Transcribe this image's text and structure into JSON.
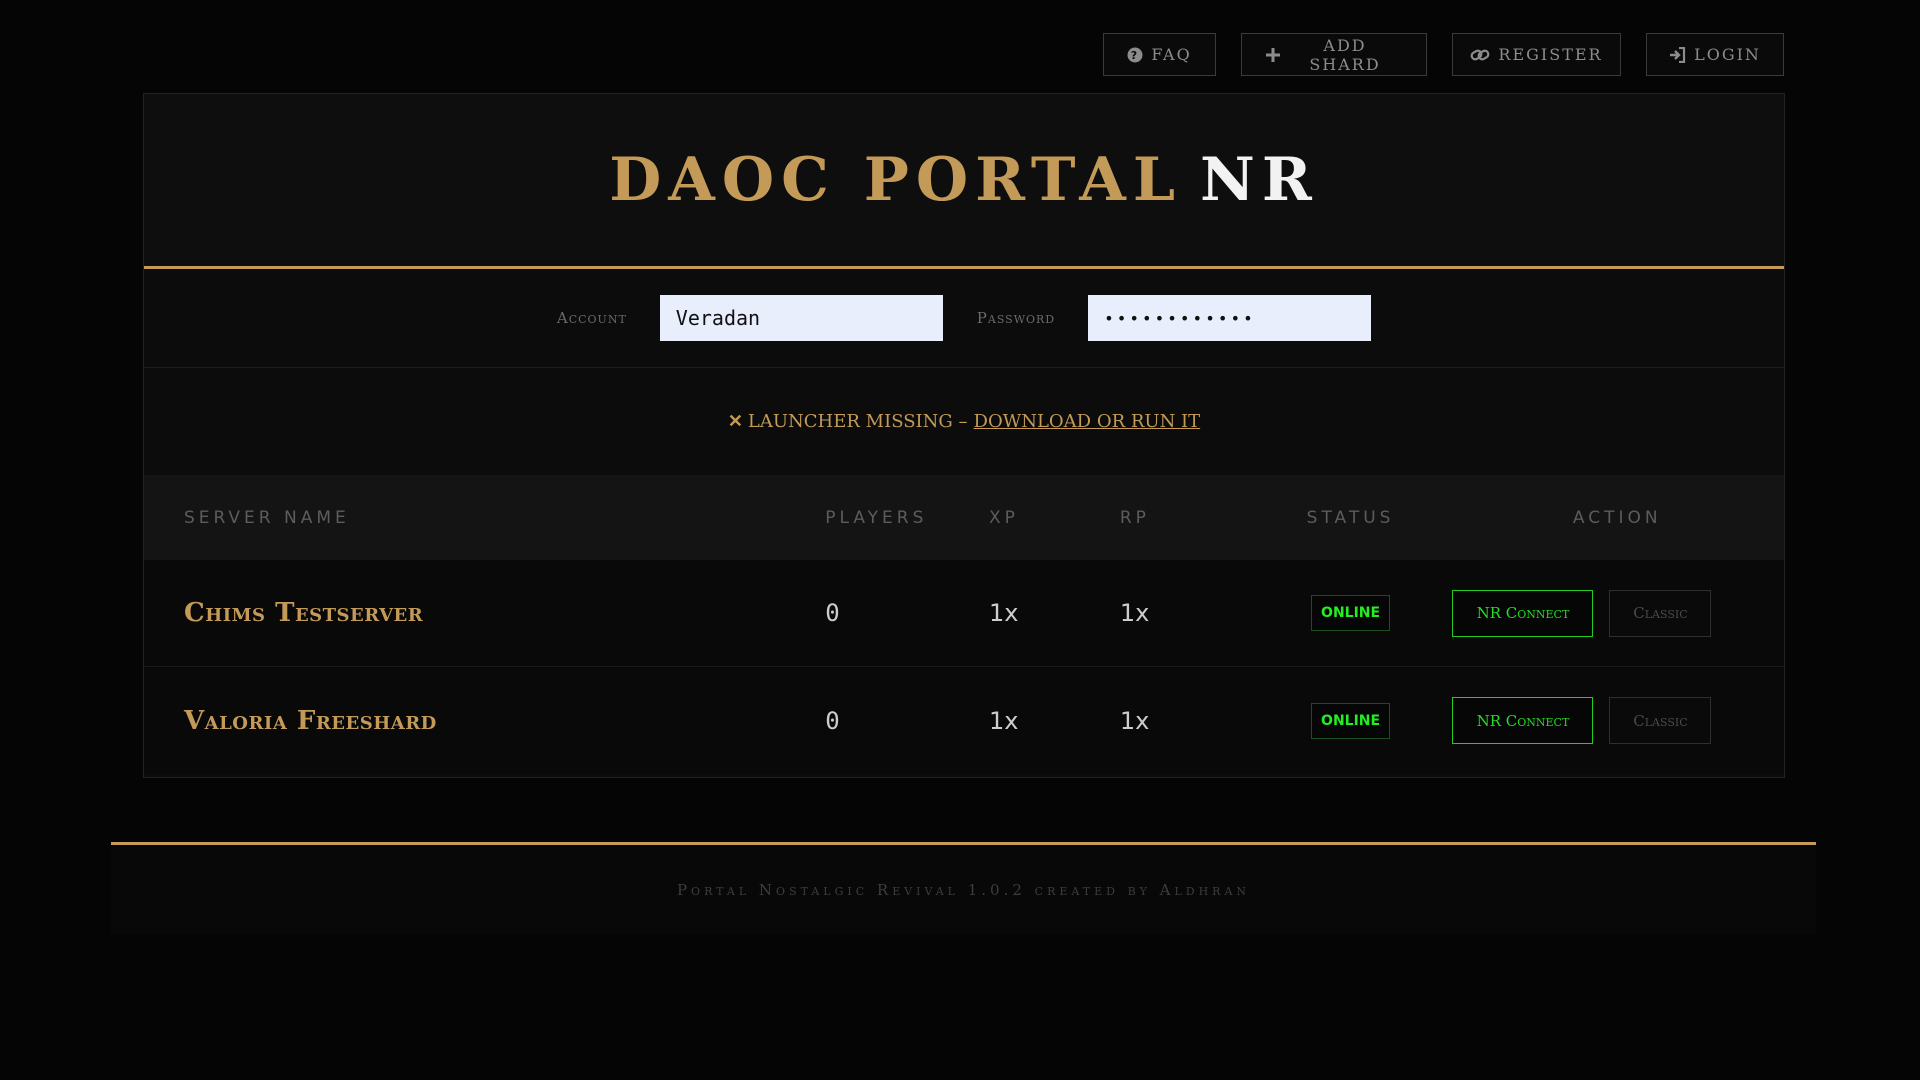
{
  "nav": {
    "faq": "FAQ",
    "add_shard": "ADD SHARD",
    "register": "REGISTER",
    "login": "LOGIN"
  },
  "hero": {
    "title_main": "DAOC PORTAL",
    "title_accent": "NR"
  },
  "login_form": {
    "account_label": "Account",
    "account_value": "Veradan",
    "password_label": "Password",
    "password_value": "••••••••••••"
  },
  "alert": {
    "icon": "x-icon",
    "text": "LAUNCHER MISSING –",
    "link_text": "DOWNLOAD OR RUN IT"
  },
  "table": {
    "headers": {
      "server_name": "SERVER NAME",
      "players": "PLAYERS",
      "xp": "XP",
      "rp": "RP",
      "status": "STATUS",
      "action": "ACTION"
    },
    "rows": [
      {
        "name": "Chims Testserver",
        "players": "0",
        "xp": "1x",
        "rp": "1x",
        "status": "ONLINE",
        "connect_label": "NR Connect",
        "classic_label": "Classic"
      },
      {
        "name": "Valoria Freeshard",
        "players": "0",
        "xp": "1x",
        "rp": "1x",
        "status": "ONLINE",
        "connect_label": "NR Connect",
        "classic_label": "Classic"
      }
    ]
  },
  "footer": {
    "text": "Portal Nostalgic Revival 1.0.2 created by Aldhran"
  },
  "colors": {
    "gold": "#c39a57",
    "online_green": "#22ee22",
    "background": "#050505"
  }
}
